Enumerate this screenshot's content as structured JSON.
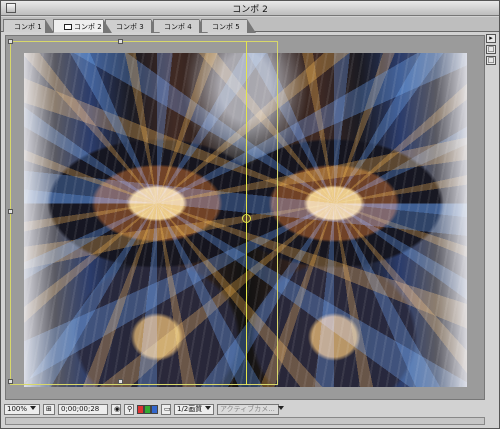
{
  "window": {
    "title": "コンポ 2"
  },
  "tabs": [
    {
      "label": "コンポ 1",
      "active": false
    },
    {
      "label": "コンポ 2",
      "active": true
    },
    {
      "label": "コンポ 3",
      "active": false
    },
    {
      "label": "コンポ 4",
      "active": false
    },
    {
      "label": "コンポ 5",
      "active": false
    }
  ],
  "side_buttons": {
    "menu": "▸",
    "a": "□",
    "b": "□"
  },
  "bottom": {
    "zoom": "100%",
    "timecode": "0;00;00;28",
    "resolution": "1/2画質",
    "camera": "アクティブカメ..."
  },
  "colors": {
    "layer_bounds": "#d8d86a",
    "guide_line": "#e5e54a",
    "red": "#d33",
    "green": "#3a3",
    "blue": "#36c"
  }
}
